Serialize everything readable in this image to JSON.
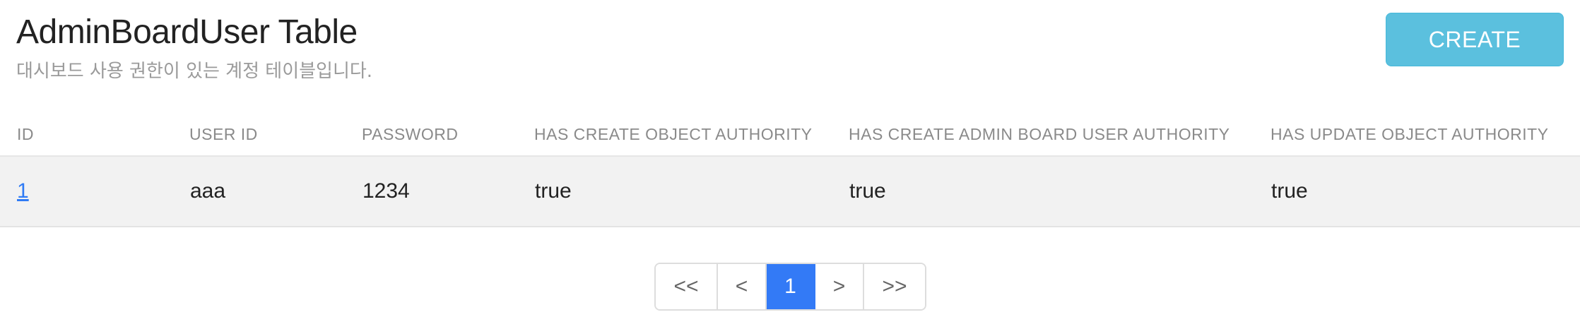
{
  "header": {
    "title": "AdminBoardUser Table",
    "subtitle": "대시보드 사용 권한이 있는 계정 테이블입니다.",
    "create_label": "CREATE"
  },
  "table": {
    "columns": [
      "ID",
      "USER ID",
      "PASSWORD",
      "HAS CREATE OBJECT AUTHORITY",
      "HAS CREATE ADMIN BOARD USER AUTHORITY",
      "HAS UPDATE OBJECT AUTHORITY"
    ],
    "rows": [
      [
        "1",
        "aaa",
        "1234",
        "true",
        "true",
        "true"
      ]
    ]
  },
  "pagination": {
    "first": "<<",
    "prev": "<",
    "current": "1",
    "next": ">",
    "last": ">>"
  },
  "colors": {
    "create_button": "#5bc0de",
    "active_page": "#337af6",
    "link": "#2f7bf5",
    "row_background": "#f2f2f2"
  }
}
